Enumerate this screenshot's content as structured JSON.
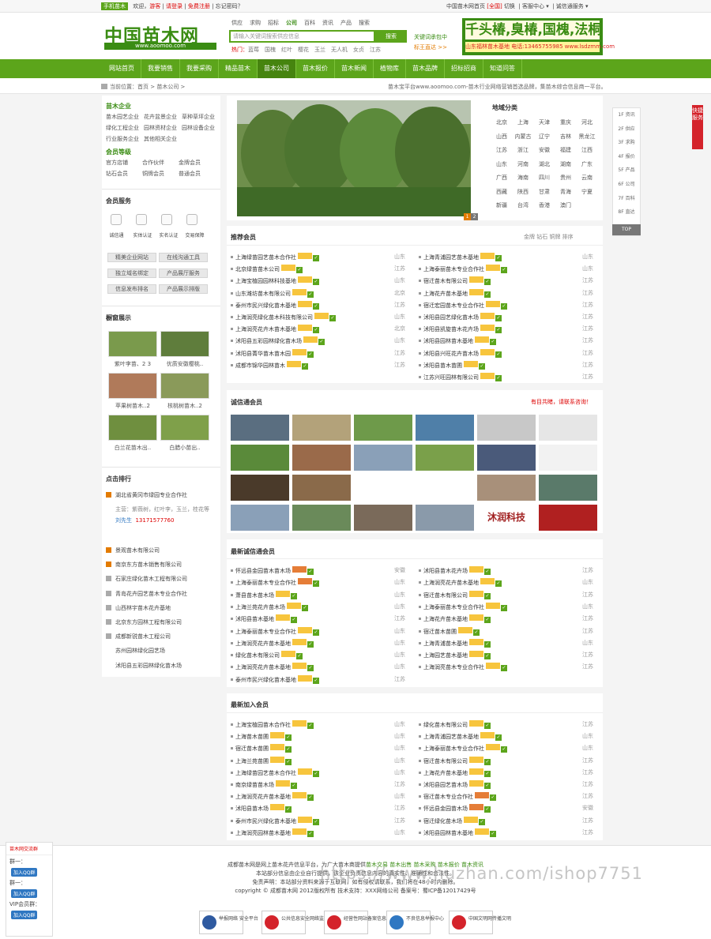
{
  "topbar": {
    "mobile": "手机苗木",
    "welcome": "欢迎，",
    "guest": "游客",
    "login": "请登录",
    "register": "免费注册",
    "forgot": "忘记密码？",
    "site": "中国苗木网首页",
    "region": "[全国]",
    "switch": "切换",
    "customer_center": "客服中心 ▾",
    "services": "诚信通服务 ▾"
  },
  "header": {
    "logo_text": "中国苗木网",
    "logo_url_text": "www.aoomoo.com",
    "search_tabs": [
      "供应",
      "求购",
      "招标",
      "公司",
      "百科",
      "资讯",
      "产品",
      "搜索"
    ],
    "search_tab_active": "公司",
    "search_placeholder": "请输入关键词搜索供应信息",
    "search_button": "搜索",
    "hot_label": "热门：",
    "hot_words": [
      "蓝莓",
      "国槐",
      "红叶",
      "樱花",
      "玉兰",
      "无人机",
      "女贞",
      "江苏"
    ],
    "keyword_join": "关键词承包中",
    "banner_line1": "千头椿,臭椿,国槐,法桐",
    "banner_line2": "山东福林苗木基地  电话:13465755985  www.lsdzmm.com",
    "keyword_more": "标王直达 >>"
  },
  "nav": {
    "items": [
      "网站首页",
      "我要销售",
      "我要采购",
      "精品苗木",
      "苗木公司",
      "苗木报价",
      "苗木新闻",
      "植物库",
      "苗木品牌",
      "招标招商",
      "知道问答"
    ],
    "active": "苗木公司"
  },
  "crumb": {
    "location": "当前位置：",
    "home": "首页",
    "current": "苗木公司 >",
    "slogan": "苗木宝平台www.aoomoo.com-苗木行业网络营销首选品牌，集苗木综合信息商一平台。"
  },
  "left": {
    "company_title": "苗木企业",
    "company_links": [
      "苗木园艺企业",
      "花卉盆景企业",
      "草种草坪企业",
      "绿化工程企业",
      "园林资材企业",
      "园林设备企业",
      "行业服务企业",
      "其他相关企业"
    ],
    "member_title": "会员等级",
    "member_links": [
      "官方店铺",
      "合作伙伴",
      "金牌会员",
      "钻石会员",
      "铜牌会员",
      "普通会员"
    ],
    "service_title": "会员服务",
    "service_items": [
      "诚信通",
      "实体认证",
      "实名认证",
      "交易保障"
    ],
    "service_buttons": [
      "精美企业网站",
      "在线沟通工具",
      "独立域名绑定",
      "产品展厅服务",
      "信息发布排名",
      "产品展示排版"
    ],
    "showcase_title": "橱窗展示",
    "showcase_caps": [
      "紫叶李苗、2 3",
      "优质安徽樱桃..",
      "苹果树苗木..2",
      "核桃树苗木..2",
      "白兰花苗木出..",
      "白腊小苗出.."
    ],
    "rank_title": "点击排行",
    "rank_first": "湖北省黄冈市绿园专业合作社",
    "rank_first_sub": "主营：紫薇树，红叶李，玉兰，桂花等",
    "rank_first_contact": "刘先生",
    "rank_first_phone": "13171577760",
    "rank_items": [
      "景观苗木有限公司",
      "南京东方苗木销售有限公司",
      "石家庄绿化苗木工程有限公司",
      "青岛花卉园艺苗木专业合作社",
      "山西林宇苗木花卉基地",
      "北京东方园林工程有限公司",
      "成都新锐苗木工程公司",
      "苏州园林绿化园艺场",
      "沭阳县五彩园林绿化苗木场"
    ]
  },
  "hero": {
    "pager": [
      "1",
      "2"
    ]
  },
  "province": {
    "title": "地域分类",
    "items": [
      "北京",
      "上海",
      "天津",
      "重庆",
      "河北",
      "山西",
      "内蒙古",
      "辽宁",
      "吉林",
      "黑龙江",
      "江苏",
      "浙江",
      "安徽",
      "福建",
      "江西",
      "山东",
      "河南",
      "湖北",
      "湖南",
      "广东",
      "广西",
      "海南",
      "四川",
      "贵州",
      "云南",
      "西藏",
      "陕西",
      "甘肃",
      "青海",
      "宁夏",
      "新疆",
      "台湾",
      "香港",
      "澳门"
    ]
  },
  "recommend": {
    "title": "推荐会员",
    "legend": "金牌  钻石  铜牌  排序",
    "left": [
      {
        "name": "上海绿苗园艺苗木合作社",
        "loc": "山东"
      },
      {
        "name": "北京绿苗苗木公司",
        "loc": "江苏"
      },
      {
        "name": "上海宝植园园林科技基地",
        "loc": "山东"
      },
      {
        "name": "山东潍坊苗木有限公司",
        "loc": "北京"
      },
      {
        "name": "泰州市民兴绿化苗木基地",
        "loc": "江苏"
      },
      {
        "name": "上海润亮绿化苗木科技有限公司",
        "loc": "山东"
      },
      {
        "name": "上海润亮花卉木苗木基地",
        "loc": "北京"
      },
      {
        "name": "沭阳县五彩园林绿化苗木场",
        "loc": "山东"
      },
      {
        "name": "沭阳县菁华苗木苗木园",
        "loc": "江苏"
      },
      {
        "name": "成都市锦华园林苗木",
        "loc": "江苏"
      }
    ],
    "right": [
      {
        "name": "上海青浦园艺苗木基地",
        "loc": "山东"
      },
      {
        "name": "上海泰丽苗木专业合作社",
        "loc": "山东"
      },
      {
        "name": "宿迁苗木有限公司",
        "loc": "江苏"
      },
      {
        "name": "上海花卉苗木基地",
        "loc": "江苏"
      },
      {
        "name": "宿迁宏园苗木专业合作社",
        "loc": "江苏"
      },
      {
        "name": "沭阳县园艺绿化苗木场",
        "loc": "江苏"
      },
      {
        "name": "沭阳县凯旋苗木花卉场",
        "loc": "江苏"
      },
      {
        "name": "沭阳县园林苗木基地",
        "loc": "江苏"
      },
      {
        "name": "沭阳县兴旺花卉苗木场",
        "loc": "江苏"
      },
      {
        "name": "沭阳县苗木苗圃",
        "loc": "江苏"
      },
      {
        "name": "江苏兴旺园林有限公司",
        "loc": "江苏"
      }
    ]
  },
  "honest": {
    "title": "诚信通会员",
    "more": "有目共睹，请联系咨询！",
    "photo_label": "沐润科技"
  },
  "latest_honest": {
    "title": "最新诚信通会员",
    "left": [
      {
        "name": "怀远县金园苗木苗木场",
        "loc": "安徽",
        "red": true
      },
      {
        "name": "上海泰丽苗木专业合作社",
        "loc": "山东",
        "red": true
      },
      {
        "name": "萧县苗木苗木场",
        "loc": "山东"
      },
      {
        "name": "上海兰苑花卉苗木场",
        "loc": "山东"
      },
      {
        "name": "沭阳县苗木基地",
        "loc": "江苏"
      },
      {
        "name": "上海泰丽苗木专业合作社",
        "loc": "山东"
      },
      {
        "name": "上海润亮花卉苗木基地",
        "loc": "山东"
      },
      {
        "name": "绿化苗木有限公司",
        "loc": "山东"
      },
      {
        "name": "上海润亮花卉苗木基地",
        "loc": "山东"
      },
      {
        "name": "泰州市民兴绿化苗木基地",
        "loc": "江苏"
      }
    ],
    "right": [
      {
        "name": "沭阳县苗木花卉场",
        "loc": "江苏"
      },
      {
        "name": "上海润亮花卉苗木基地",
        "loc": "山东"
      },
      {
        "name": "宿迁苗木有限公司",
        "loc": "江苏"
      },
      {
        "name": "上海泰丽苗木专业合作社",
        "loc": "山东"
      },
      {
        "name": "上海花卉苗木基地",
        "loc": "江苏"
      },
      {
        "name": "宿迁苗木苗圃",
        "loc": "江苏"
      },
      {
        "name": "上海青浦苗木基地",
        "loc": "山东"
      },
      {
        "name": "上海园艺苗木基地",
        "loc": "江苏"
      },
      {
        "name": "上海润亮苗木专业合作社",
        "loc": "江苏"
      }
    ]
  },
  "latest_join": {
    "title": "最新加入会员",
    "left": [
      {
        "name": "上海宝植园苗木合作社",
        "loc": "山东"
      },
      {
        "name": "上海苗木苗圃",
        "loc": "山东"
      },
      {
        "name": "宿迁苗木苗圃",
        "loc": "山东"
      },
      {
        "name": "上海兰苑苗圃",
        "loc": "山东"
      },
      {
        "name": "上海绿苗园艺苗木合作社",
        "loc": "山东"
      },
      {
        "name": "南京绿苗苗木场",
        "loc": "江苏"
      },
      {
        "name": "上海润亮花卉苗木基地",
        "loc": "山东"
      },
      {
        "name": "沭阳县苗木场",
        "loc": "江苏"
      },
      {
        "name": "泰州市民兴绿化苗木基地",
        "loc": "江苏"
      },
      {
        "name": "上海润亮园林苗木基地",
        "loc": "山东"
      }
    ],
    "right": [
      {
        "name": "绿化苗木有限公司",
        "loc": "江苏"
      },
      {
        "name": "上海青浦园艺苗木基地",
        "loc": "山东"
      },
      {
        "name": "上海泰丽苗木专业合作社",
        "loc": "山东"
      },
      {
        "name": "宿迁苗木有限公司",
        "loc": "江苏"
      },
      {
        "name": "上海花卉苗木基地",
        "loc": "江苏"
      },
      {
        "name": "沭阳县园艺苗木场",
        "loc": "江苏"
      },
      {
        "name": "宿迁苗木专业合作社",
        "loc": "江苏",
        "red": true
      },
      {
        "name": "怀远县金园苗木场",
        "loc": "安徽",
        "red": true
      },
      {
        "name": "宿迁绿化苗木场",
        "loc": "江苏"
      },
      {
        "name": "沭阳县园林苗木基地",
        "loc": "江苏"
      }
    ]
  },
  "sidefloat": {
    "items": [
      "1F 资讯",
      "2F 供应",
      "3F 求购",
      "4F 报价",
      "5F 产品",
      "6F 公司",
      "7F 百科",
      "8F 直达"
    ],
    "top": "TOP",
    "quick": "快捷服务"
  },
  "qq": {
    "title": "苗木网交流群",
    "g1": "群一：",
    "g2": "群一：",
    "g3": "VIP会员群：",
    "btn": "加入QQ群"
  },
  "footer": {
    "line1_pre": "成都苗木网是网上苗木花卉信息平台，为广大苗木商提供",
    "line1_links": [
      "苗木交易",
      "苗木出售",
      "苗木采购",
      "苗木报价",
      "苗木资讯"
    ],
    "line2": "本站部分信息由企业自行提供，该企业负责信息内容的真实性、准确性和合法性。",
    "line3": "免责声明：本站部分资料来源于互联网，如有侵权请联系，我们将在48小时内删除。",
    "copyright": "copyright © 成都苗木网 2012版权所有 技术支持：XXX网络公司 备案号：蜀ICP备12017429号",
    "badges": [
      "举报网络 安全平台",
      "公共信息安全网络监察",
      "经营性网站备案信息",
      "不良信息举报中心",
      "中国文明网传播文明"
    ]
  },
  "watermark": "https://www.huzhan.com/ishop7751"
}
